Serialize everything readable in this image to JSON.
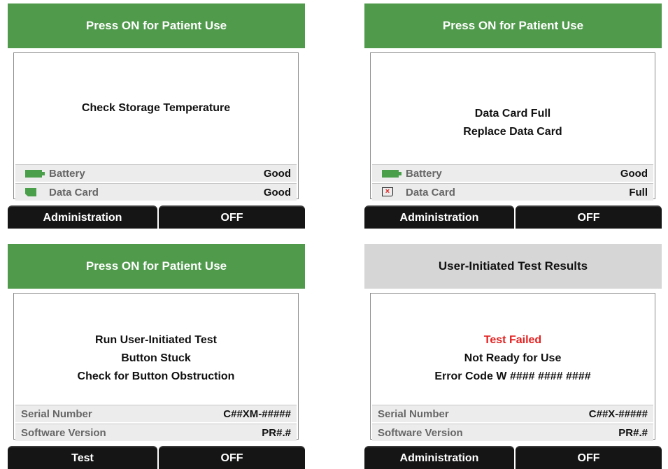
{
  "colors": {
    "header_green": "#4f9a4b",
    "header_grey": "#d6d6d6",
    "ok_green": "#4aa04a",
    "error_red": "#e41f1f"
  },
  "screens": [
    {
      "header": "Press ON for Patient Use",
      "messages": [
        "Check Storage Temperature"
      ],
      "rows": [
        {
          "icon": "battery-icon",
          "label": "Battery",
          "value": "Good"
        },
        {
          "icon": "data-card-icon",
          "label": "Data Card",
          "value": "Good"
        }
      ],
      "buttons": [
        "Administration",
        "OFF"
      ]
    },
    {
      "header": "Press ON for Patient Use",
      "messages": [
        "Data Card Full",
        "Replace Data Card"
      ],
      "rows": [
        {
          "icon": "battery-icon",
          "label": "Battery",
          "value": "Good"
        },
        {
          "icon": "data-card-error-icon",
          "label": "Data Card",
          "value": "Full"
        }
      ],
      "buttons": [
        "Administration",
        "OFF"
      ]
    },
    {
      "header": "Press ON for Patient Use",
      "messages": [
        "Run User-Initiated Test",
        "Button Stuck",
        "Check for Button Obstruction"
      ],
      "rows": [
        {
          "label": "Serial Number",
          "value": "C##XM-#####"
        },
        {
          "label": "Software Version",
          "value": "PR#.#"
        }
      ],
      "buttons": [
        "Test",
        "OFF"
      ]
    },
    {
      "header": "User-Initiated Test Results",
      "messages": [
        "Test Failed",
        "Not Ready for Use",
        "Error Code W #### #### ####"
      ],
      "rows": [
        {
          "label": "Serial Number",
          "value": "C##X-#####"
        },
        {
          "label": "Software Version",
          "value": "PR#.#"
        }
      ],
      "buttons": [
        "Administration",
        "OFF"
      ]
    }
  ]
}
